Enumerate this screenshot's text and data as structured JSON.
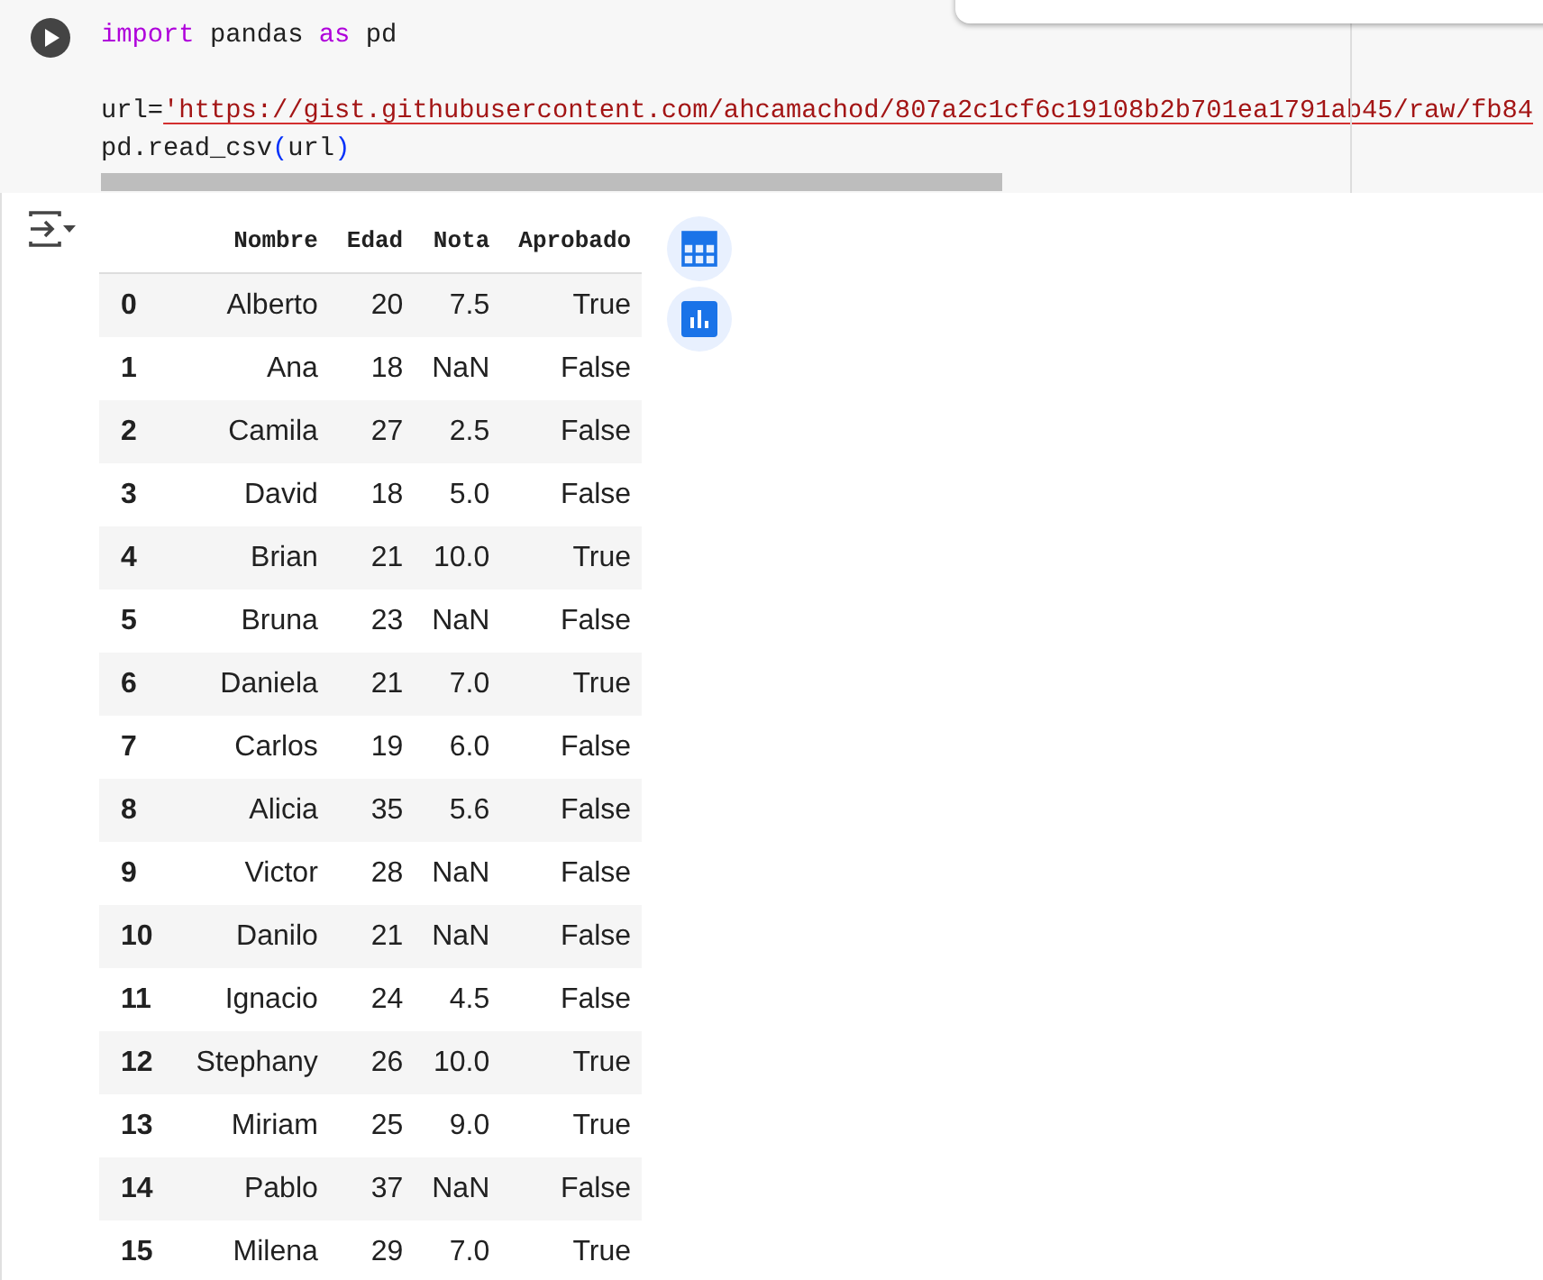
{
  "code_cell": {
    "lines": [
      {
        "kind": "code",
        "tokens": [
          {
            "kind": "keyword",
            "text": "import"
          },
          {
            "kind": "plain",
            "text": " pandas "
          },
          {
            "kind": "keyword",
            "text": "as"
          },
          {
            "kind": "plain",
            "text": " pd"
          }
        ]
      },
      {
        "kind": "blank"
      },
      {
        "kind": "code",
        "tokens": [
          {
            "kind": "plain",
            "text": "url="
          },
          {
            "kind": "string",
            "text": "'https://gist.githubusercontent.com/ahcamachod/807a2c1cf6c19108b2b701ea1791ab45/raw/fb84"
          }
        ]
      },
      {
        "kind": "code",
        "tokens": [
          {
            "kind": "plain",
            "text": "pd.read_csv"
          },
          {
            "kind": "paren",
            "text": "("
          },
          {
            "kind": "plain",
            "text": "url"
          },
          {
            "kind": "paren",
            "text": ")"
          }
        ]
      }
    ]
  },
  "output": {
    "table": {
      "columns": [
        "Nombre",
        "Edad",
        "Nota",
        "Aprobado"
      ],
      "rows": [
        {
          "index": "0",
          "cells": [
            "Alberto",
            "20",
            "7.5",
            "True"
          ]
        },
        {
          "index": "1",
          "cells": [
            "Ana",
            "18",
            "NaN",
            "False"
          ]
        },
        {
          "index": "2",
          "cells": [
            "Camila",
            "27",
            "2.5",
            "False"
          ]
        },
        {
          "index": "3",
          "cells": [
            "David",
            "18",
            "5.0",
            "False"
          ]
        },
        {
          "index": "4",
          "cells": [
            "Brian",
            "21",
            "10.0",
            "True"
          ]
        },
        {
          "index": "5",
          "cells": [
            "Bruna",
            "23",
            "NaN",
            "False"
          ]
        },
        {
          "index": "6",
          "cells": [
            "Daniela",
            "21",
            "7.0",
            "True"
          ]
        },
        {
          "index": "7",
          "cells": [
            "Carlos",
            "19",
            "6.0",
            "False"
          ]
        },
        {
          "index": "8",
          "cells": [
            "Alicia",
            "35",
            "5.6",
            "False"
          ]
        },
        {
          "index": "9",
          "cells": [
            "Victor",
            "28",
            "NaN",
            "False"
          ]
        },
        {
          "index": "10",
          "cells": [
            "Danilo",
            "21",
            "NaN",
            "False"
          ]
        },
        {
          "index": "11",
          "cells": [
            "Ignacio",
            "24",
            "4.5",
            "False"
          ]
        },
        {
          "index": "12",
          "cells": [
            "Stephany",
            "26",
            "10.0",
            "True"
          ]
        },
        {
          "index": "13",
          "cells": [
            "Miriam",
            "25",
            "9.0",
            "True"
          ]
        },
        {
          "index": "14",
          "cells": [
            "Pablo",
            "37",
            "NaN",
            "False"
          ]
        },
        {
          "index": "15",
          "cells": [
            "Milena",
            "29",
            "7.0",
            "True"
          ]
        }
      ]
    }
  }
}
